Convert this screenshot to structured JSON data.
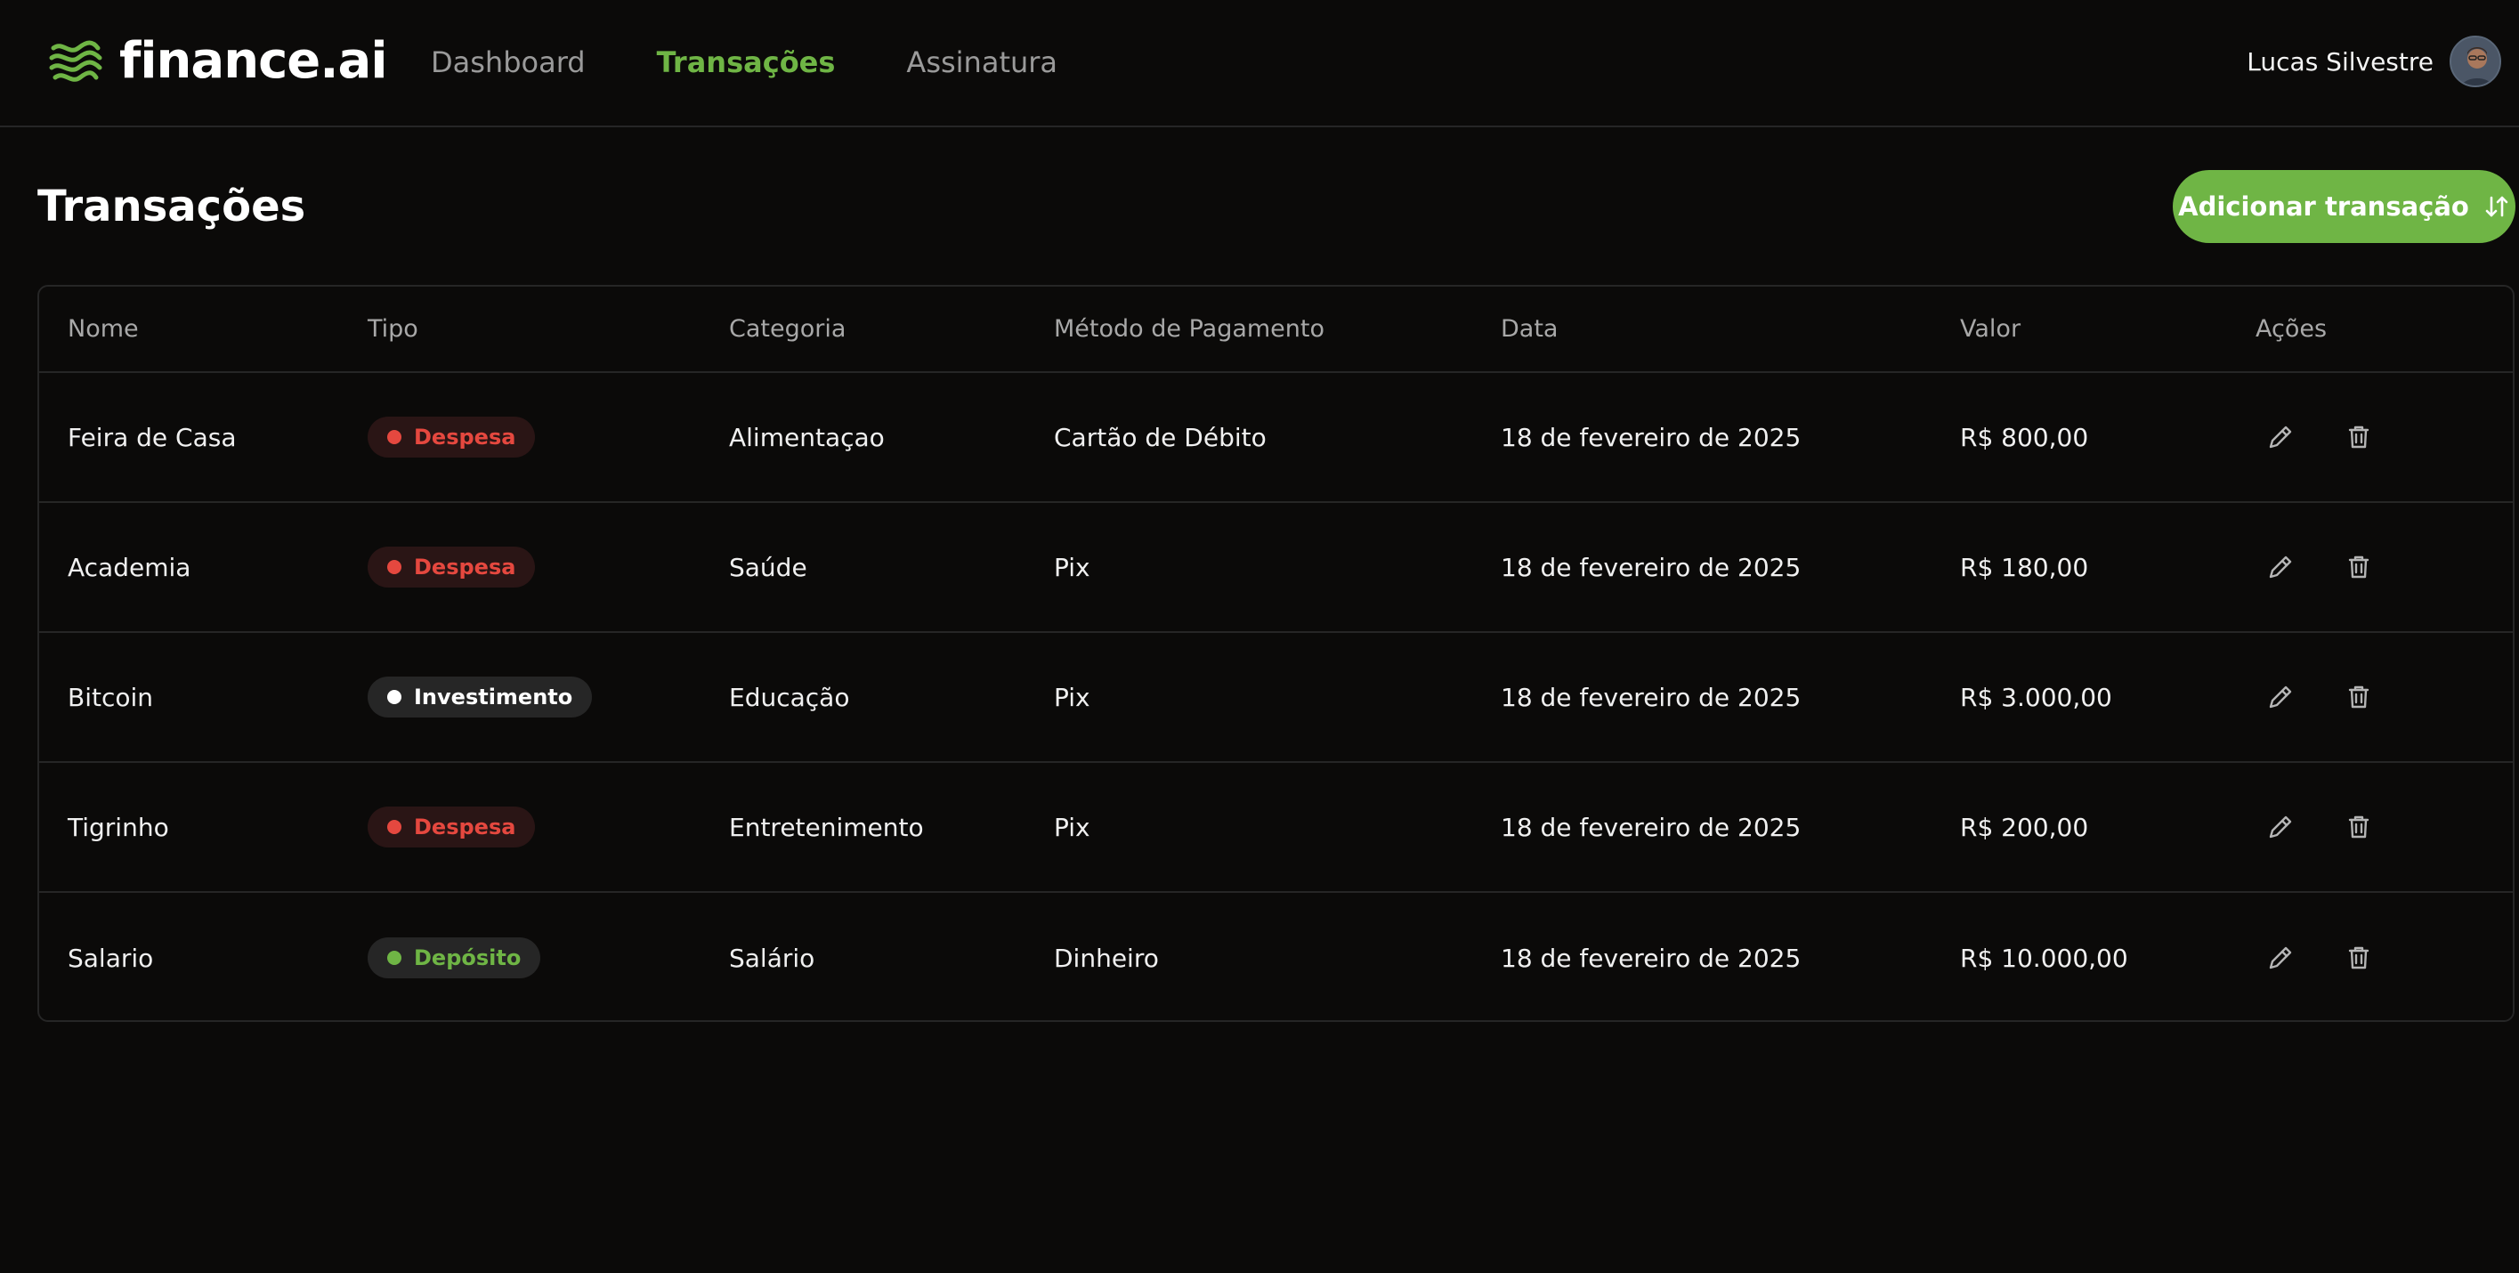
{
  "brand": {
    "name": "finance.ai",
    "color": "#6fb545"
  },
  "nav": {
    "items": [
      {
        "label": "Dashboard",
        "active": false
      },
      {
        "label": "Transações",
        "active": true
      },
      {
        "label": "Assinatura",
        "active": false
      }
    ]
  },
  "user": {
    "name": "Lucas Silvestre"
  },
  "page": {
    "title": "Transações",
    "add_button_label": "Adicionar transação"
  },
  "table": {
    "columns": [
      "Nome",
      "Tipo",
      "Categoria",
      "Método de Pagamento",
      "Data",
      "Valor",
      "Ações"
    ],
    "rows": [
      {
        "nome": "Feira de Casa",
        "tipo": "Despesa",
        "tipo_kind": "despesa",
        "categoria": "Alimentaçao",
        "metodo": "Cartão de Débito",
        "data": "18 de fevereiro de 2025",
        "valor": "R$ 800,00"
      },
      {
        "nome": "Academia",
        "tipo": "Despesa",
        "tipo_kind": "despesa",
        "categoria": "Saúde",
        "metodo": "Pix",
        "data": "18 de fevereiro de 2025",
        "valor": "R$ 180,00"
      },
      {
        "nome": "Bitcoin",
        "tipo": "Investimento",
        "tipo_kind": "investimento",
        "categoria": "Educação",
        "metodo": "Pix",
        "data": "18 de fevereiro de 2025",
        "valor": "R$ 3.000,00"
      },
      {
        "nome": "Tigrinho",
        "tipo": "Despesa",
        "tipo_kind": "despesa",
        "categoria": "Entretenimento",
        "metodo": "Pix",
        "data": "18 de fevereiro de 2025",
        "valor": "R$ 200,00"
      },
      {
        "nome": "Salario",
        "tipo": "Depósito",
        "tipo_kind": "deposito",
        "categoria": "Salário",
        "metodo": "Dinheiro",
        "data": "18 de fevereiro de 2025",
        "valor": "R$ 10.000,00"
      }
    ]
  },
  "colors": {
    "background": "#0b0a09",
    "accent": "#6fb545",
    "expense": "#e5483f",
    "border": "#262626"
  },
  "icons": {
    "logo": "wave-logo-icon",
    "add": "sort-arrows-icon",
    "edit": "pencil-icon",
    "delete": "trash-icon"
  }
}
